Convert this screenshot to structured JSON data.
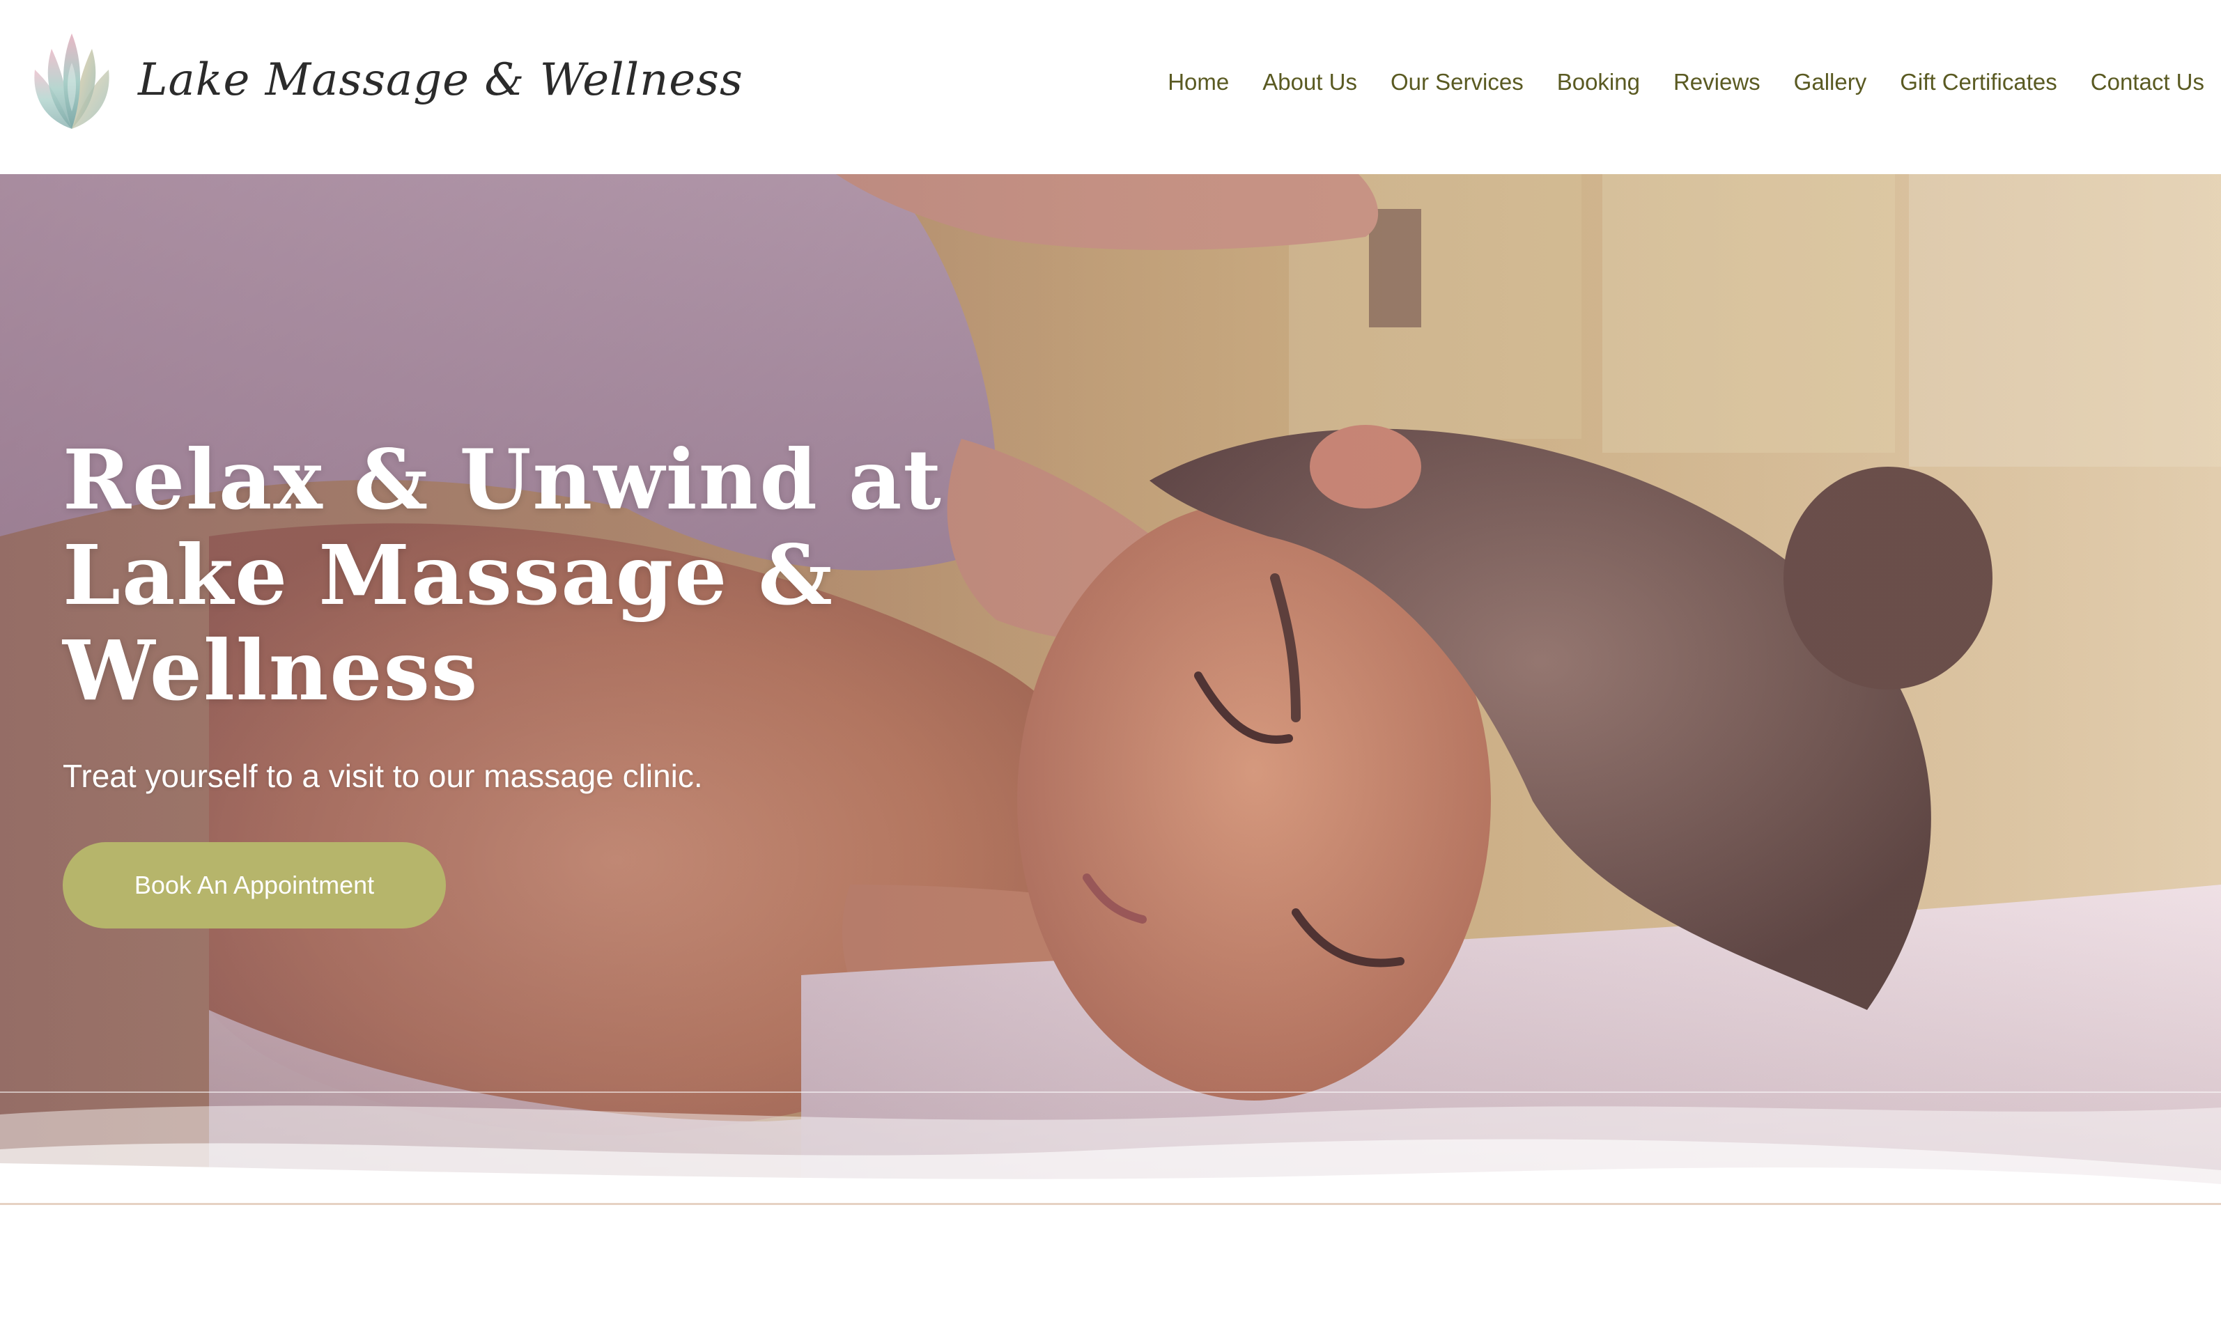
{
  "brand": {
    "name": "Lake Massage & Wellness",
    "logo_icon": "lotus-icon"
  },
  "nav": {
    "items": [
      {
        "label": "Home"
      },
      {
        "label": "About Us"
      },
      {
        "label": "Our Services"
      },
      {
        "label": "Booking"
      },
      {
        "label": "Reviews"
      },
      {
        "label": "Gallery"
      },
      {
        "label": "Gift Certificates"
      },
      {
        "label": "Contact Us"
      }
    ]
  },
  "hero": {
    "title": "Relax & Unwind at Lake Massage & Wellness",
    "subtitle": "Treat yourself to a visit to our massage clinic.",
    "cta_label": "Book An Appointment",
    "image": "woman-receiving-back-massage"
  },
  "colors": {
    "nav_text": "#5a5a22",
    "accent_button": "#b6b56b",
    "logo_text": "#2b2b2b"
  }
}
